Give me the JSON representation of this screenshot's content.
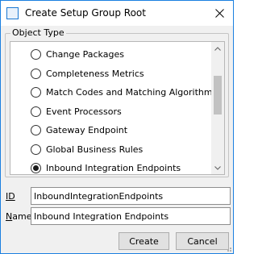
{
  "window": {
    "title": "Create Setup Group Root",
    "icon": "window-icon"
  },
  "object_type": {
    "legend": "Object Type",
    "options": [
      {
        "label": "Change Packages",
        "checked": false
      },
      {
        "label": "Completeness Metrics",
        "checked": false
      },
      {
        "label": "Match Codes and Matching Algorithms",
        "checked": false
      },
      {
        "label": "Event Processors",
        "checked": false
      },
      {
        "label": "Gateway Endpoint",
        "checked": false
      },
      {
        "label": "Global Business Rules",
        "checked": false
      },
      {
        "label": "Inbound Integration Endpoints",
        "checked": true
      }
    ]
  },
  "fields": {
    "id": {
      "label": "ID",
      "value": "InboundIntegrationEndpoints"
    },
    "name": {
      "label": "Name",
      "value": "Inbound Integration Endpoints"
    }
  },
  "buttons": {
    "create": "Create",
    "cancel": "Cancel"
  }
}
